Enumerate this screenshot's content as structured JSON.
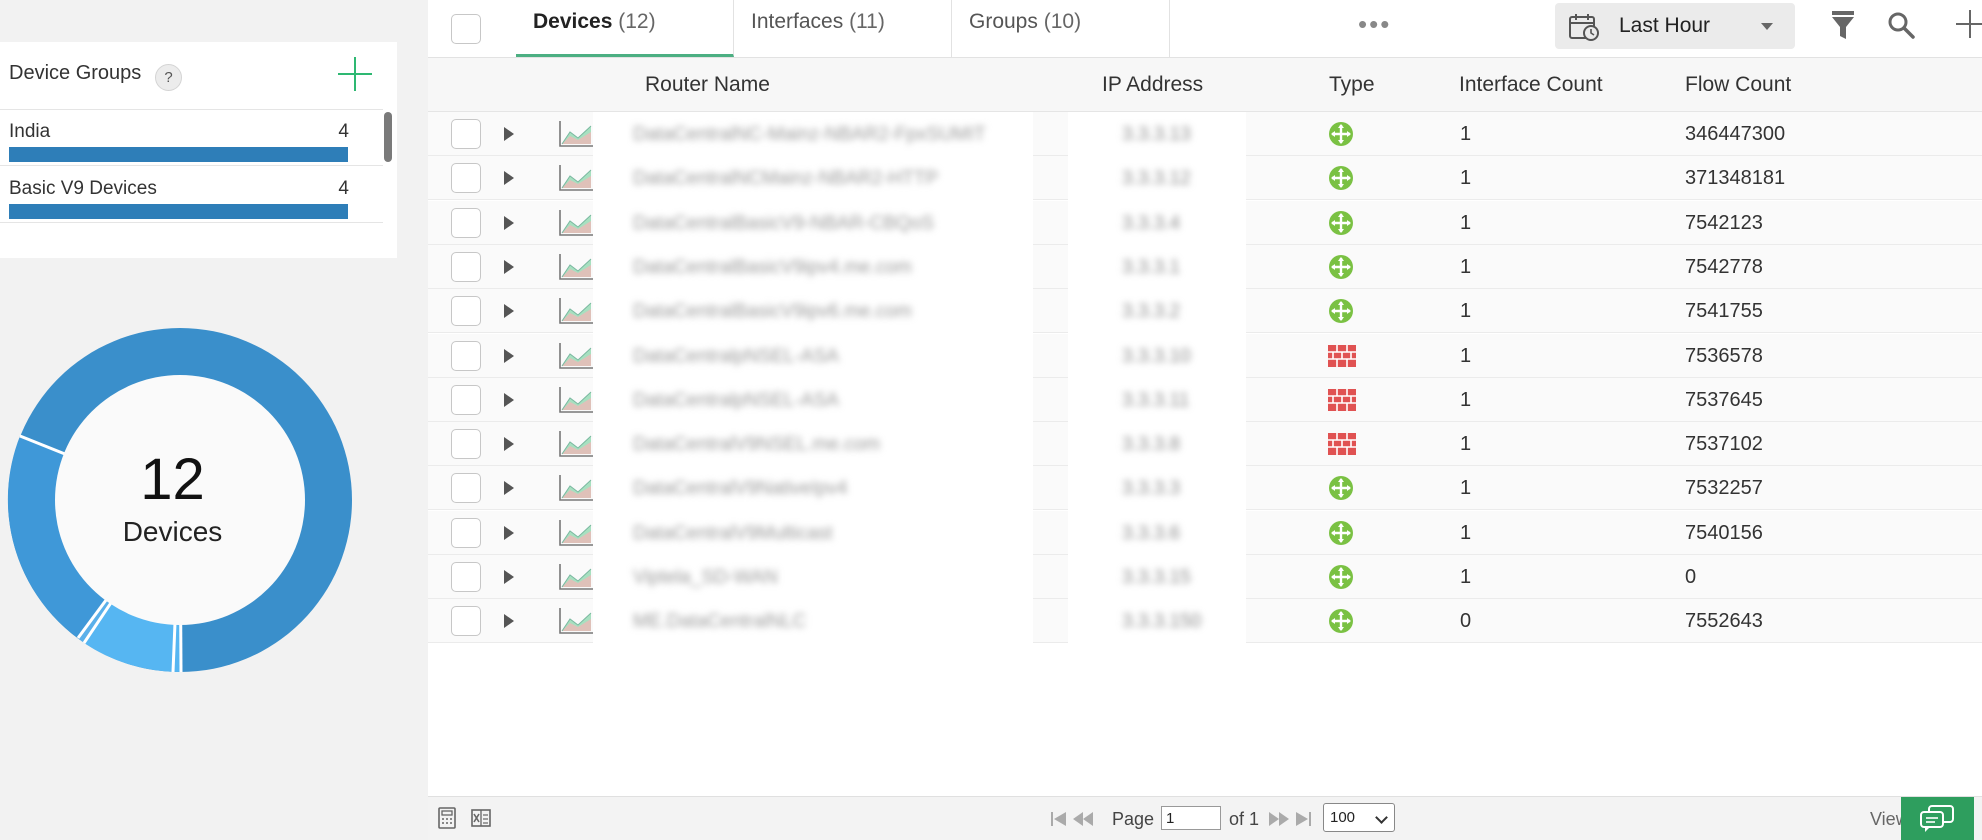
{
  "device_groups": {
    "title": "Device Groups",
    "help": "?",
    "items": [
      {
        "name": "India",
        "count": "4"
      },
      {
        "name": "Basic V9 Devices",
        "count": "4"
      }
    ]
  },
  "donut": {
    "total": "12",
    "label": "Devices"
  },
  "tabs": [
    {
      "label": "Devices",
      "count": "(12)"
    },
    {
      "label": "Interfaces",
      "count": "(11)"
    },
    {
      "label": "Groups",
      "count": "(10)"
    }
  ],
  "more_label": "•••",
  "time_range": "Last Hour",
  "columns": {
    "router_name": "Router Name",
    "ip_address": "IP Address",
    "type": "Type",
    "interface_count": "Interface Count",
    "flow_count": "Flow Count"
  },
  "rows": [
    {
      "name": "DataCentralNC-Mainz-NBAR2-FpxSUMIT",
      "ip": "3.3.3.13",
      "type": "router",
      "interfaces": "1",
      "flows": "346447300"
    },
    {
      "name": "DataCentralNCMainz-NBAR2-HTTP",
      "ip": "3.3.3.12",
      "type": "router",
      "interfaces": "1",
      "flows": "371348181"
    },
    {
      "name": "DataCentralBasicV9-NBAR-CBQoS",
      "ip": "3.3.3.4",
      "type": "router",
      "interfaces": "1",
      "flows": "7542123"
    },
    {
      "name": "DataCentralBasicV9ipv4.me.com",
      "ip": "3.3.3.1",
      "type": "router",
      "interfaces": "1",
      "flows": "7542778"
    },
    {
      "name": "DataCentralBasicV9ipv6.me.com",
      "ip": "3.3.3.2",
      "type": "router",
      "interfaces": "1",
      "flows": "7541755"
    },
    {
      "name": "DataCentralpNSEL-ASA",
      "ip": "3.3.3.10",
      "type": "firewall",
      "interfaces": "1",
      "flows": "7536578"
    },
    {
      "name": "DataCentralpNSEL-ASA",
      "ip": "3.3.3.11",
      "type": "firewall",
      "interfaces": "1",
      "flows": "7537645"
    },
    {
      "name": "DataCentralV9NSEL.me.com",
      "ip": "3.3.3.8",
      "type": "firewall",
      "interfaces": "1",
      "flows": "7537102"
    },
    {
      "name": "DataCentralV9NativeIpv4",
      "ip": "3.3.3.3",
      "type": "router",
      "interfaces": "1",
      "flows": "7532257"
    },
    {
      "name": "DataCentralV9Multicast",
      "ip": "3.3.3.6",
      "type": "router",
      "interfaces": "1",
      "flows": "7540156"
    },
    {
      "name": "Viptela_SD-WAN",
      "ip": "3.3.3.15",
      "type": "router",
      "interfaces": "1",
      "flows": "0"
    },
    {
      "name": "ME.DataCentralNLC",
      "ip": "3.3.3.150",
      "type": "router",
      "interfaces": "0",
      "flows": "7552643"
    }
  ],
  "pagination": {
    "page_label": "Page",
    "page_value": "1",
    "of_label": "of 1",
    "per_page": "100",
    "view_label": "View"
  },
  "colors": {
    "accent_green": "#2eb872",
    "bar_blue": "#2e7eb8",
    "donut_blues": [
      "#3a8fcb",
      "#3f98d8",
      "#56b6f2"
    ],
    "router_type": "#7ac143",
    "firewall_type": "#e05252"
  }
}
